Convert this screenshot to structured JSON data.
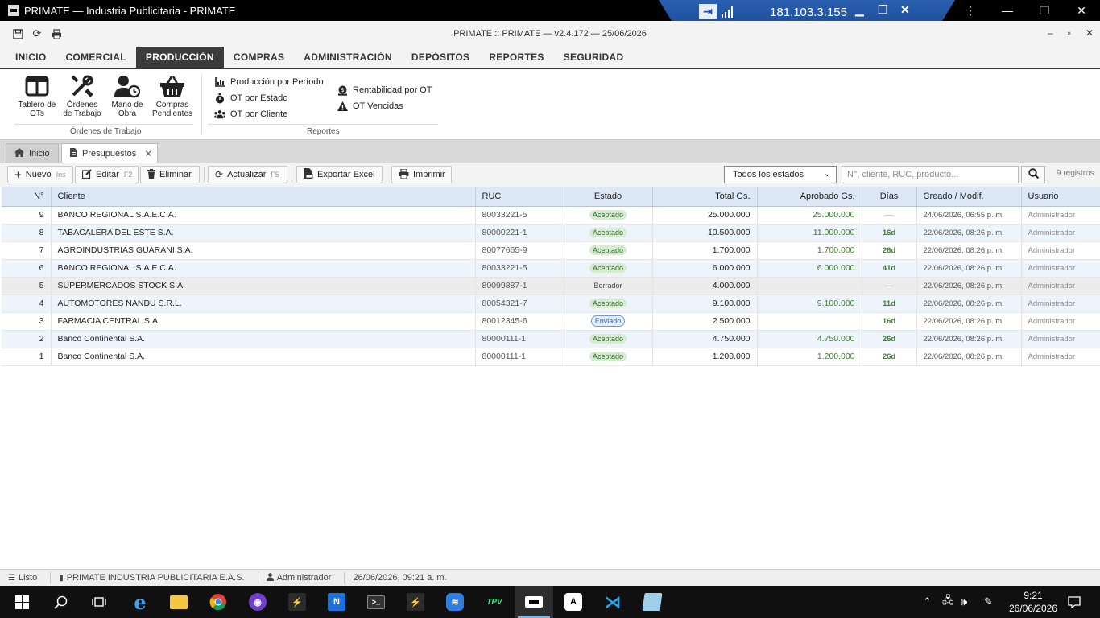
{
  "window": {
    "title": "PRIMATE — Industria Publicitaria - PRIMATE",
    "remote_ip": "181.103.3.155"
  },
  "app": {
    "title": "PRIMATE :: PRIMATE — v2.4.172 — 25/06/2026"
  },
  "menu": {
    "items": [
      "INICIO",
      "COMERCIAL",
      "PRODUCCIÓN",
      "COMPRAS",
      "ADMINISTRACIÓN",
      "DEPÓSITOS",
      "REPORTES",
      "SEGURIDAD"
    ],
    "active": "PRODUCCIÓN"
  },
  "ribbon": {
    "ordenes_group": {
      "label": "Órdenes de Trabajo",
      "items": [
        {
          "line1": "Tablero de",
          "line2": "OTs",
          "icon": "board-icon"
        },
        {
          "line1": "Órdenes",
          "line2": "de Trabajo",
          "icon": "tools-icon"
        },
        {
          "line1": "Mano de",
          "line2": "Obra",
          "icon": "user-clock-icon"
        },
        {
          "line1": "Compras",
          "line2": "Pendientes",
          "icon": "basket-icon"
        }
      ]
    },
    "reportes_group": {
      "label": "Reportes",
      "col1": [
        "Producción por Período",
        "OT por Estado",
        "OT por Cliente"
      ],
      "col2": [
        "Rentabilidad por OT",
        "OT Vencidas"
      ]
    }
  },
  "tabs": {
    "inicio": "Inicio",
    "presupuestos": "Presupuestos"
  },
  "toolbar": {
    "nuevo": "Nuevo",
    "nuevo_key": "Ins",
    "editar": "Editar",
    "editar_key": "F2",
    "eliminar": "Eliminar",
    "actualizar": "Actualizar",
    "actualizar_key": "F5",
    "exportar": "Exportar Excel",
    "imprimir": "Imprimir",
    "estado_filter": "Todos los estados",
    "search_placeholder": "N°, cliente, RUC, producto...",
    "record_count": "9 registros"
  },
  "table": {
    "headers": {
      "num": "N°",
      "cliente": "Cliente",
      "ruc": "RUC",
      "estado": "Estado",
      "total": "Total Gs.",
      "aprobado": "Aprobado Gs.",
      "dias": "Días",
      "creado": "Creado / Modif.",
      "usuario": "Usuario"
    },
    "rows": [
      {
        "num": "9",
        "cliente": "BANCO REGIONAL S.A.E.C.A.",
        "ruc": "80033221-5",
        "estado": "Aceptado",
        "total": "25.000.000",
        "aprobado": "25.000.000",
        "dias": "—",
        "creado": "24/06/2026, 06:55 p. m.",
        "usuario": "Administrador"
      },
      {
        "num": "8",
        "cliente": "TABACALERA DEL ESTE S.A.",
        "ruc": "80000221-1",
        "estado": "Aceptado",
        "total": "10.500.000",
        "aprobado": "11.000.000",
        "dias": "16d",
        "creado": "22/06/2026, 08:26 p. m.",
        "usuario": "Administrador"
      },
      {
        "num": "7",
        "cliente": "AGROINDUSTRIAS GUARANI S.A.",
        "ruc": "80077665-9",
        "estado": "Aceptado",
        "total": "1.700.000",
        "aprobado": "1.700.000",
        "dias": "26d",
        "creado": "22/06/2026, 08:26 p. m.",
        "usuario": "Administrador"
      },
      {
        "num": "6",
        "cliente": "BANCO REGIONAL S.A.E.C.A.",
        "ruc": "80033221-5",
        "estado": "Aceptado",
        "total": "6.000.000",
        "aprobado": "6.000.000",
        "dias": "41d",
        "creado": "22/06/2026, 08:26 p. m.",
        "usuario": "Administrador"
      },
      {
        "num": "5",
        "cliente": "SUPERMERCADOS STOCK S.A.",
        "ruc": "80099887-1",
        "estado": "Borrador",
        "total": "4.000.000",
        "aprobado": "",
        "dias": "—",
        "creado": "22/06/2026, 08:26 p. m.",
        "usuario": "Administrador"
      },
      {
        "num": "4",
        "cliente": "AUTOMOTORES NANDU S.R.L.",
        "ruc": "80054321-7",
        "estado": "Aceptado",
        "total": "9.100.000",
        "aprobado": "9.100.000",
        "dias": "11d",
        "creado": "22/06/2026, 08:26 p. m.",
        "usuario": "Administrador"
      },
      {
        "num": "3",
        "cliente": "FARMACIA CENTRAL S.A.",
        "ruc": "80012345-6",
        "estado": "Enviado",
        "total": "2.500.000",
        "aprobado": "",
        "dias": "16d",
        "creado": "22/06/2026, 08:26 p. m.",
        "usuario": "Administrador"
      },
      {
        "num": "2",
        "cliente": "Banco Continental S.A.",
        "ruc": "80000111-1",
        "estado": "Aceptado",
        "total": "4.750.000",
        "aprobado": "4.750.000",
        "dias": "26d",
        "creado": "22/06/2026, 08:26 p. m.",
        "usuario": "Administrador"
      },
      {
        "num": "1",
        "cliente": "Banco Continental S.A.",
        "ruc": "80000111-1",
        "estado": "Aceptado",
        "total": "1.200.000",
        "aprobado": "1.200.000",
        "dias": "26d",
        "creado": "22/06/2026, 08:26 p. m.",
        "usuario": "Administrador"
      }
    ]
  },
  "statusbar": {
    "status": "Listo",
    "company": "PRIMATE INDUSTRIA PUBLICITARIA E.A.S.",
    "user": "Administrador",
    "datetime": "26/06/2026, 09:21 a. m."
  },
  "taskbar": {
    "time": "9:21",
    "date": "26/06/2026"
  },
  "colors": {
    "accent_active_menu": "#3b3b3b",
    "grid_header": "#dce8f5",
    "approved_green": "#3f7f2e",
    "rdp_blue": "#1f4f9c"
  }
}
